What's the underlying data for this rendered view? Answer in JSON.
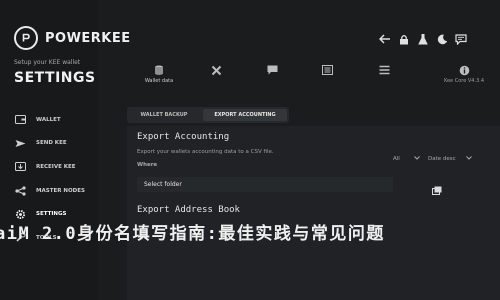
{
  "brand": {
    "name": "POWERKEE"
  },
  "sidebar": {
    "setup_text": "Setup your KEE wallet",
    "title": "SETTINGS",
    "items": [
      {
        "label": "WALLET",
        "icon": "wallet-icon"
      },
      {
        "label": "SEND KEE",
        "icon": "send-icon"
      },
      {
        "label": "RECEIVE KEE",
        "icon": "receive-icon"
      },
      {
        "label": "MASTER NODES",
        "icon": "nodes-icon"
      },
      {
        "label": "SETTINGS",
        "icon": "gear-icon",
        "active": true
      },
      {
        "label": "TOOLS",
        "icon": "tools-icon"
      }
    ]
  },
  "topbar": {
    "icons": [
      "back-icon",
      "lock-icon",
      "flask-icon",
      "moon-icon",
      "chat-icon"
    ]
  },
  "tabs": [
    {
      "label": "Wallet data",
      "icon": "database-icon",
      "active": true
    },
    {
      "label": "",
      "icon": "cross-icon"
    },
    {
      "label": "",
      "icon": "chat-icon"
    },
    {
      "label": "",
      "icon": "menu-icon"
    },
    {
      "label": "",
      "icon": "list-icon"
    },
    {
      "label": "Kee Core V4.3.4",
      "icon": "info-icon"
    }
  ],
  "segments": {
    "wallet_backup": "WALLET BACKUP",
    "export_accounting": "EXPORT ACCOUNTING"
  },
  "export_accounting": {
    "title": "Export Accounting",
    "description": "Export your wallets accounting data to a CSV file.",
    "where_label": "Where",
    "filter_value": "All",
    "sort_value": "Date desc",
    "folder_placeholder": "Select folder"
  },
  "export_address_book": {
    "title": "Export Address Book"
  },
  "caption": "aiM 2.0身份名填写指南:最佳实践与常见问题"
}
